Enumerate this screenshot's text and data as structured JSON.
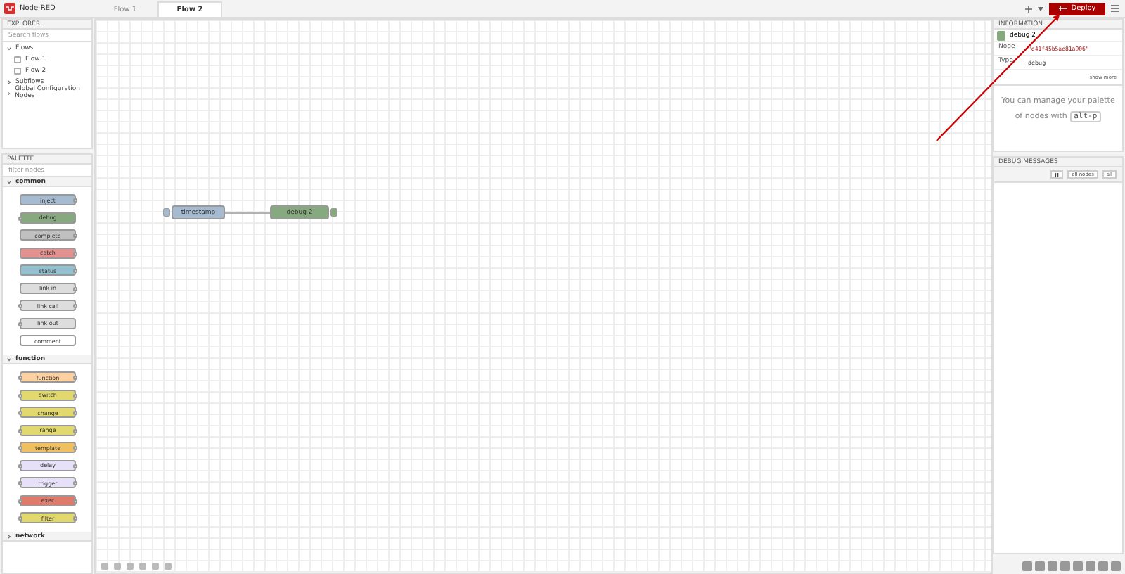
{
  "app": {
    "title": "Node-RED"
  },
  "tabs": [
    {
      "label": "Flow 1",
      "selected": false
    },
    {
      "label": "Flow 2",
      "selected": true
    }
  ],
  "deploy": {
    "label": "Deploy"
  },
  "explorer": {
    "title": "EXPLORER",
    "search": {
      "placeholder": "Search flows"
    },
    "tree": [
      {
        "label": "Flows",
        "expanded": true,
        "children": [
          {
            "label": "Flow 1"
          },
          {
            "label": "Flow 2"
          }
        ]
      },
      {
        "label": "Subflows",
        "expanded": false
      },
      {
        "label": "Global Configuration Nodes",
        "expanded": false
      }
    ]
  },
  "palette": {
    "title": "PALETTE",
    "filter": {
      "placeholder": "filter nodes"
    },
    "categories": [
      {
        "label": "common",
        "expanded": true,
        "nodes": [
          {
            "label": "inject",
            "color": "#a6bbcf",
            "in": false,
            "out": true
          },
          {
            "label": "debug",
            "color": "#87a980",
            "in": true,
            "out": false
          },
          {
            "label": "complete",
            "color": "#c0c0c0",
            "in": false,
            "out": true
          },
          {
            "label": "catch",
            "color": "#e49191",
            "in": false,
            "out": true
          },
          {
            "label": "status",
            "color": "#94c1d0",
            "in": false,
            "out": true
          },
          {
            "label": "link in",
            "color": "#dddddd",
            "in": false,
            "out": true
          },
          {
            "label": "link call",
            "color": "#dddddd",
            "in": true,
            "out": true
          },
          {
            "label": "link out",
            "color": "#dddddd",
            "in": true,
            "out": false
          },
          {
            "label": "comment",
            "color": "#ffffff",
            "in": false,
            "out": false
          }
        ]
      },
      {
        "label": "function",
        "expanded": true,
        "nodes": [
          {
            "label": "function",
            "color": "#fdd0a2",
            "in": true,
            "out": true
          },
          {
            "label": "switch",
            "color": "#e2d96e",
            "in": true,
            "out": true
          },
          {
            "label": "change",
            "color": "#e2d96e",
            "in": true,
            "out": true
          },
          {
            "label": "range",
            "color": "#e2d96e",
            "in": true,
            "out": true
          },
          {
            "label": "template",
            "color": "#f0c060",
            "in": true,
            "out": true
          },
          {
            "label": "delay",
            "color": "#e6e0f8",
            "in": true,
            "out": true
          },
          {
            "label": "trigger",
            "color": "#e6e0f8",
            "in": true,
            "out": true
          },
          {
            "label": "exec",
            "color": "#e07a6a",
            "in": true,
            "out": true
          },
          {
            "label": "filter",
            "color": "#e2d96e",
            "in": true,
            "out": true
          }
        ]
      },
      {
        "label": "network",
        "expanded": false
      }
    ]
  },
  "canvas": {
    "nodes": [
      {
        "label": "timestamp",
        "color": "#a6bbcf",
        "kind": "inject"
      },
      {
        "label": "debug 2",
        "color": "#87a980",
        "kind": "debug"
      }
    ]
  },
  "info": {
    "title": "INFORMATION",
    "node_title": "debug 2",
    "rows": [
      {
        "key": "Node",
        "value": "\"e41f45b5ae81a906\""
      },
      {
        "key": "Type",
        "value": "debug"
      }
    ],
    "show_more": "show more",
    "tip": "You can manage your palette of nodes with",
    "tip_key": "alt-p"
  },
  "debug": {
    "title": "DEBUG MESSAGES",
    "filter": "all nodes",
    "clear": "all"
  }
}
